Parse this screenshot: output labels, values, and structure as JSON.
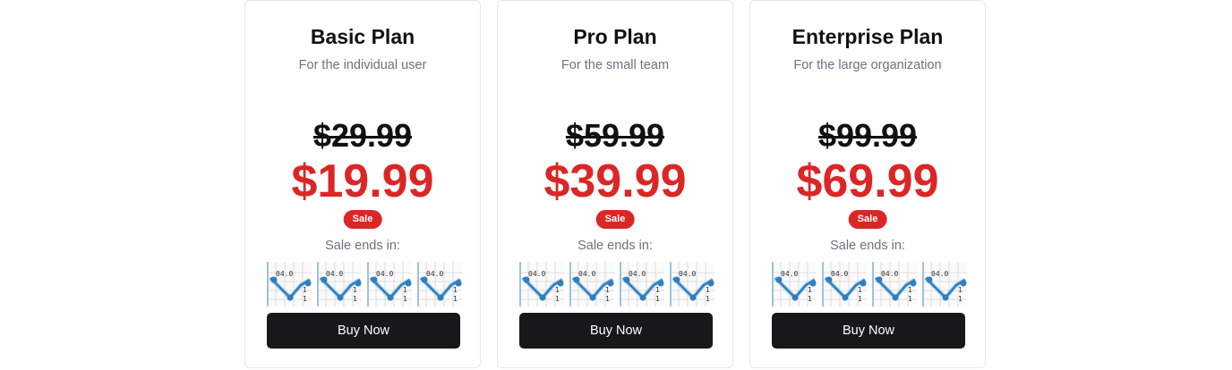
{
  "plans": [
    {
      "title": "Basic Plan",
      "subtitle": "For the individual user",
      "old_price": "$29.99",
      "new_price": "$19.99",
      "badge": "Sale",
      "ends_label": "Sale ends in:",
      "buy_label": "Buy Now"
    },
    {
      "title": "Pro Plan",
      "subtitle": "For the small team",
      "old_price": "$59.99",
      "new_price": "$39.99",
      "badge": "Sale",
      "ends_label": "Sale ends in:",
      "buy_label": "Buy Now"
    },
    {
      "title": "Enterprise Plan",
      "subtitle": "For the large organization",
      "old_price": "$99.99",
      "new_price": "$69.99",
      "badge": "Sale",
      "ends_label": "Sale ends in:",
      "buy_label": "Buy Now"
    }
  ],
  "timer_tile_icon": "broken-chart-thumbnail-icon",
  "colors": {
    "sale_red": "#dc2626",
    "button_dark": "#18181b",
    "muted_text": "#6b7280",
    "border": "#e5e7eb",
    "thumb_blue": "#2f7fbf"
  }
}
